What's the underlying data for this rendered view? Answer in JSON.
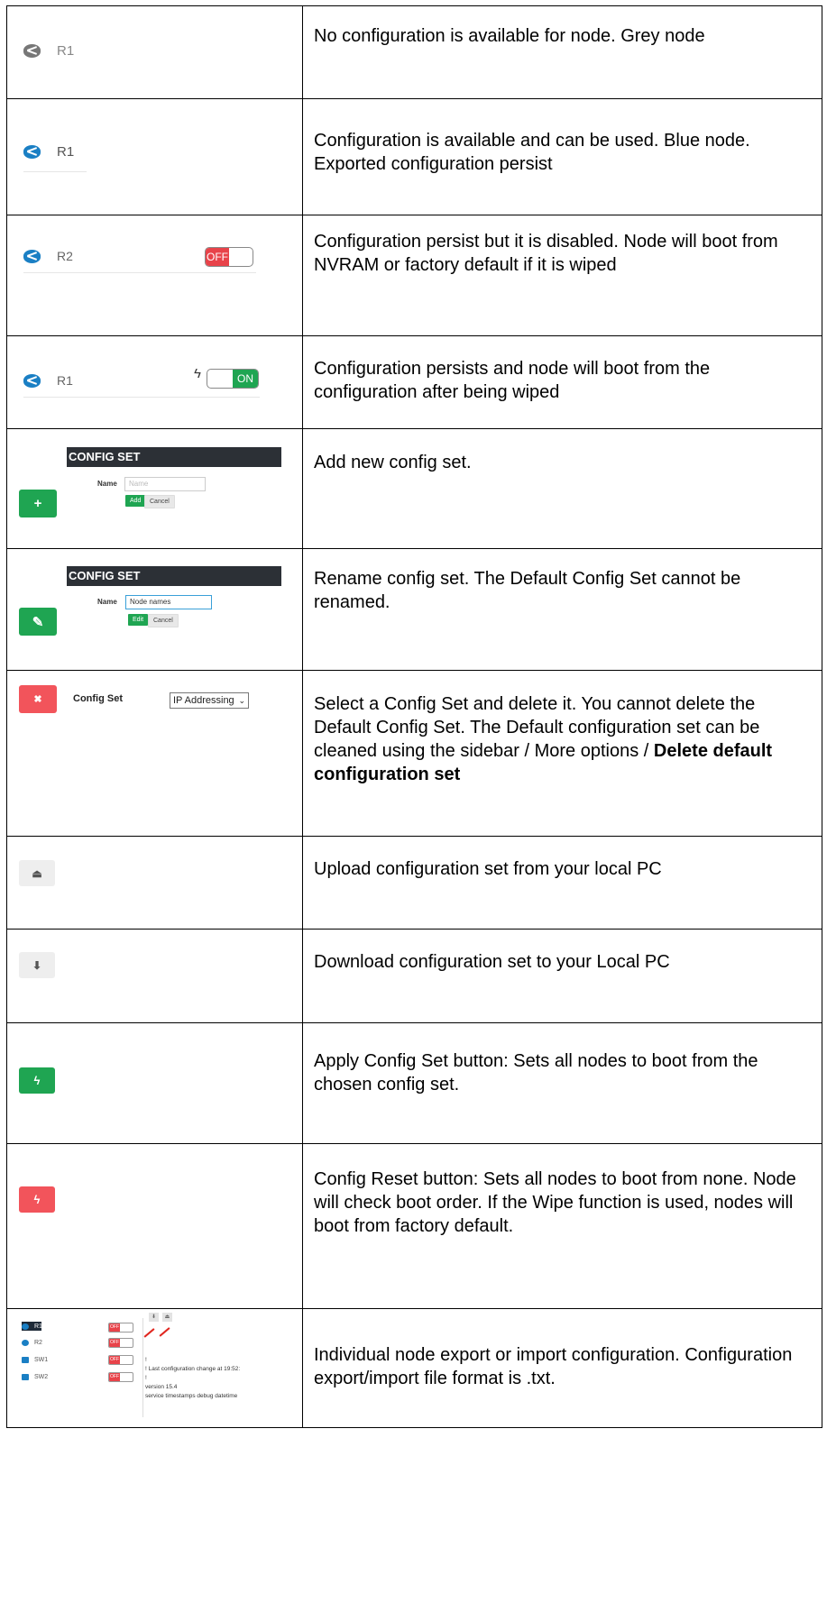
{
  "rows": [
    {
      "node_label": "R1",
      "description": "No configuration is available for node. Grey node"
    },
    {
      "node_label": "R1",
      "description": "Configuration is available and can be used. Blue node. Exported configuration persist"
    },
    {
      "node_label": "R2",
      "toggle": "OFF",
      "description": "Configuration persist but it is disabled. Node will boot from NVRAM or factory default if it is wiped"
    },
    {
      "node_label": "R1",
      "toggle": "ON",
      "description": "Configuration persists and node will boot from the configuration after being wiped"
    },
    {
      "panel_title": "CONFIG SET",
      "name_label": "Name",
      "name_placeholder": "Name",
      "primary_btn": "Add",
      "cancel_btn": "Cancel",
      "description": "Add new config set."
    },
    {
      "panel_title": "CONFIG SET",
      "name_label": "Name",
      "name_value": "Node names",
      "primary_btn": "Edit",
      "cancel_btn": "Cancel",
      "description": "Rename config set. The Default Config Set cannot be renamed."
    },
    {
      "config_set_label": "Config Set",
      "select_value": "IP Addressing",
      "description": "Select a Config Set and delete it. You cannot delete the Default Config Set. The Default configuration set can be cleaned using the sidebar / More options / ",
      "description_bold": "Delete default configuration set"
    },
    {
      "description": "Upload configuration set from your local PC"
    },
    {
      "description": "Download configuration set to your Local PC"
    },
    {
      "description": "Apply Config Set button: Sets all nodes to boot from the chosen config set."
    },
    {
      "description": "Config Reset button: Sets all nodes to boot from none. Node will check boot order. If the Wipe function is used, nodes will boot from factory default."
    },
    {
      "mini_nodes": [
        "R1",
        "R2",
        "SW1",
        "SW2"
      ],
      "mini_toggle": "OFF",
      "mini_text": [
        "!",
        "! Last configuration change at 19:52:",
        "!",
        "version 15.4",
        "service timestamps debug datetime"
      ],
      "description": "Individual node export or import configuration. Configuration export/import file format is .txt."
    }
  ],
  "colors": {
    "green": "#1fa552",
    "red": "#f2545b",
    "node_blue": "#1a7fc4",
    "node_grey": "#777777",
    "panel_dark": "#2c3036"
  },
  "icons": {
    "plus": "+",
    "edit": "✎",
    "delete": "✖",
    "upload": "⏏",
    "download": "⬇",
    "bolt": "ϟ"
  }
}
